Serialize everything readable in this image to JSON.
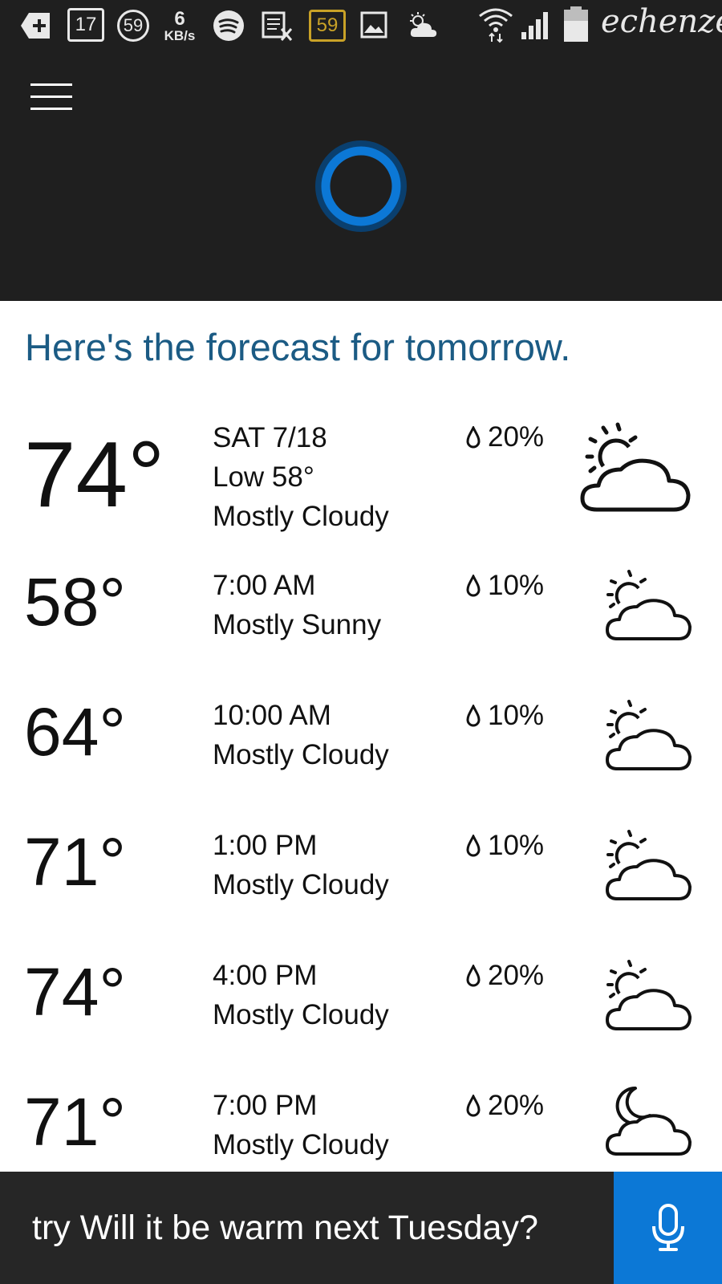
{
  "status_bar": {
    "notif_17": "17",
    "notif_59a": "59",
    "speed_value": "6",
    "speed_unit": "KB/s",
    "notif_59b": "59",
    "carrier": "echenze",
    "icons": [
      "add-icon",
      "message-icon",
      "badge-icon",
      "spotify-icon",
      "calendar-x-icon",
      "badge-icon",
      "image-icon",
      "weather-icon",
      "wifi-icon",
      "signal-icon",
      "battery-icon"
    ]
  },
  "header": {
    "menu_icon": "hamburger-icon",
    "assistant_icon": "cortana-ring-icon",
    "accent_color": "#0c78d6"
  },
  "forecast": {
    "headline": "Here's the forecast for tomorrow.",
    "headline_color": "#1b5b84",
    "summary": {
      "temp": "74°",
      "day": "SAT 7/18",
      "low": "Low 58°",
      "condition": "Mostly Cloudy",
      "precip": "20%",
      "icon": "partly-cloudy-icon"
    },
    "hours": [
      {
        "temp": "58°",
        "time": "7:00 AM",
        "condition": "Mostly Sunny",
        "precip": "10%",
        "icon": "partly-cloudy-icon"
      },
      {
        "temp": "64°",
        "time": "10:00 AM",
        "condition": "Mostly Cloudy",
        "precip": "10%",
        "icon": "partly-cloudy-icon"
      },
      {
        "temp": "71°",
        "time": "1:00 PM",
        "condition": "Mostly Cloudy",
        "precip": "10%",
        "icon": "partly-cloudy-icon"
      },
      {
        "temp": "74°",
        "time": "4:00 PM",
        "condition": "Mostly Cloudy",
        "precip": "20%",
        "icon": "partly-cloudy-icon"
      },
      {
        "temp": "71°",
        "time": "7:00 PM",
        "condition": "Mostly Cloudy",
        "precip": "20%",
        "icon": "cloudy-night-icon"
      }
    ]
  },
  "bottom_bar": {
    "prompt": "try Will it be warm next Tuesday?",
    "mic_icon": "microphone-icon"
  }
}
